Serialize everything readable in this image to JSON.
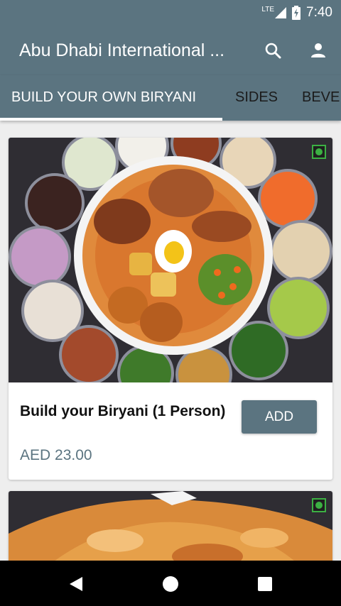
{
  "status": {
    "network": "LTE",
    "time": "7:40"
  },
  "appbar": {
    "title": "Abu Dhabi International ...",
    "search_icon": "search-icon",
    "profile_icon": "person-icon"
  },
  "tabs": [
    {
      "label": "BUILD YOUR OWN BIRYANI",
      "active": true
    },
    {
      "label": "SIDES",
      "active": false
    },
    {
      "label": "BEVE",
      "active": false
    }
  ],
  "items": [
    {
      "name": "Build your Biryani (1 Person)",
      "price": "AED 23.00",
      "add_label": "ADD",
      "veg": true
    },
    {
      "veg": true
    }
  ],
  "colors": {
    "primary": "#5b7480",
    "veg_green": "#3cb043",
    "background": "#eeeeee"
  }
}
